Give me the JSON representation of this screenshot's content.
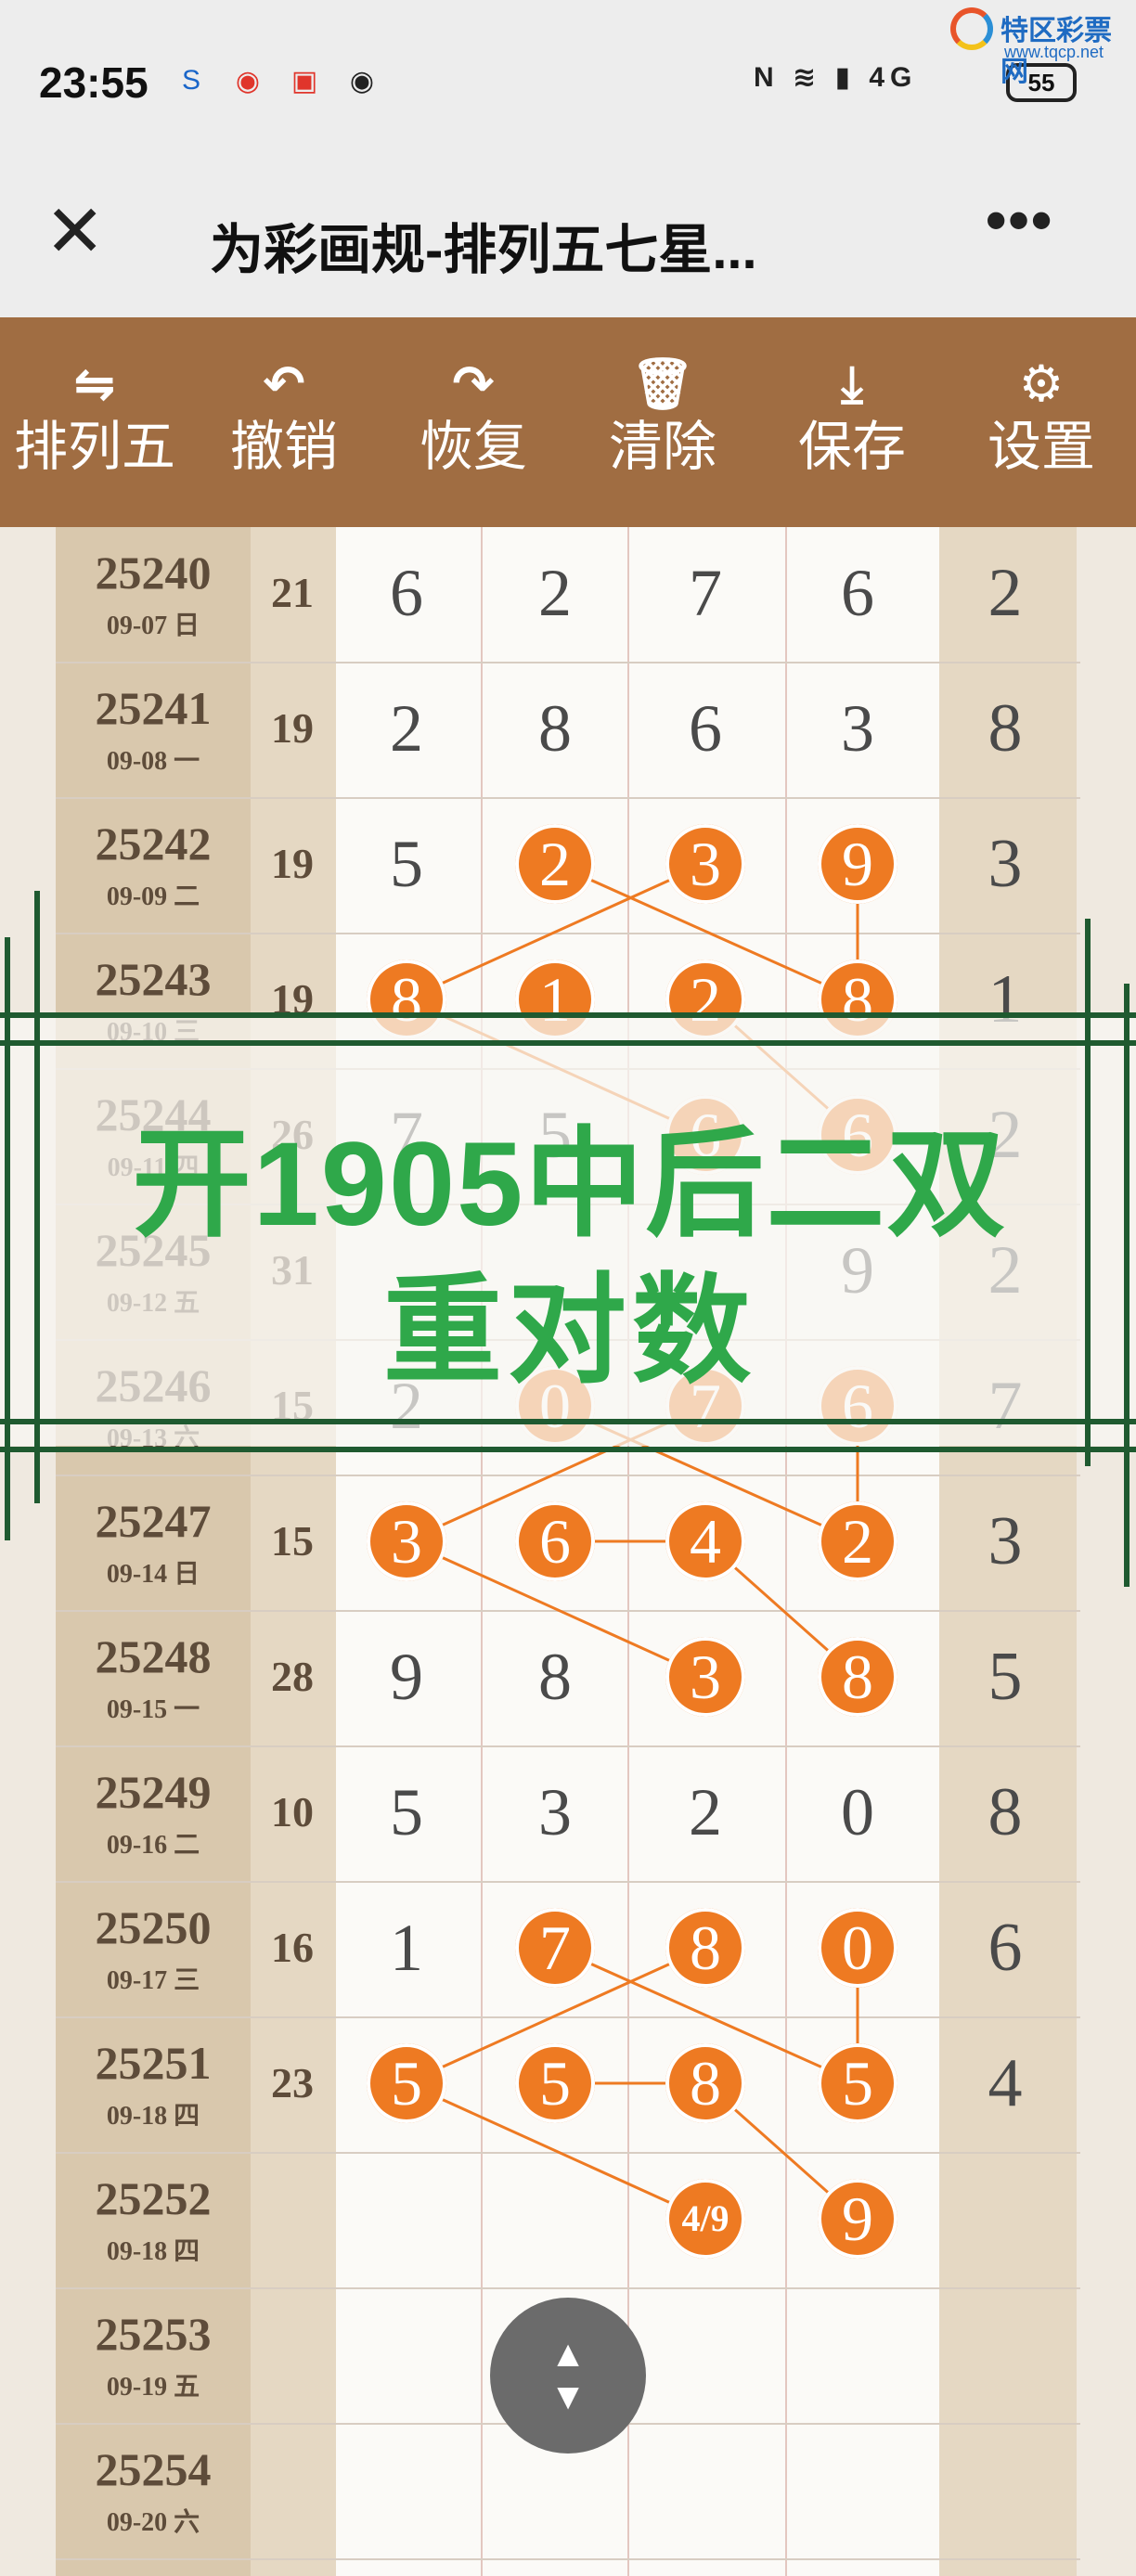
{
  "status_bar": {
    "time": "23:55",
    "battery": "55",
    "network": "4G",
    "watermark_name": "特区彩票网",
    "watermark_url": "www.tqcp.net"
  },
  "titlebar": {
    "close_icon": "close-icon",
    "title": "为彩画规-排列五七星...",
    "more_icon": "more-dots-icon"
  },
  "toolbar": [
    {
      "icon": "switch-arrows-icon",
      "glyph": "⇋",
      "label": "排列五"
    },
    {
      "icon": "undo-icon",
      "glyph": "↶",
      "label": "撤销"
    },
    {
      "icon": "redo-icon",
      "glyph": "↷",
      "label": "恢复"
    },
    {
      "icon": "trash-icon",
      "glyph": "🗑",
      "label": "清除"
    },
    {
      "icon": "download-icon",
      "glyph": "⤓",
      "label": "保存"
    },
    {
      "icon": "gear-icon",
      "glyph": "⚙",
      "label": "设置"
    }
  ],
  "table": {
    "rows": [
      {
        "period": "25240",
        "date": "09-07 日",
        "sum": "21",
        "digits": [
          "6",
          "2",
          "7",
          "6"
        ],
        "hl": [
          false,
          false,
          false,
          false
        ],
        "last": "2"
      },
      {
        "period": "25241",
        "date": "09-08 一",
        "sum": "19",
        "digits": [
          "2",
          "8",
          "6",
          "3"
        ],
        "hl": [
          false,
          false,
          false,
          false
        ],
        "last": "8"
      },
      {
        "period": "25242",
        "date": "09-09 二",
        "sum": "19",
        "digits": [
          "5",
          "2",
          "3",
          "9"
        ],
        "hl": [
          false,
          true,
          true,
          true
        ],
        "last": "3"
      },
      {
        "period": "25243",
        "date": "09-10 三",
        "sum": "19",
        "digits": [
          "8",
          "1",
          "2",
          "8"
        ],
        "hl": [
          true,
          true,
          true,
          true
        ],
        "last": "1"
      },
      {
        "period": "25244",
        "date": "09-11 四",
        "sum": "26",
        "digits": [
          "7",
          "5",
          "6",
          "6"
        ],
        "hl": [
          false,
          false,
          true,
          true
        ],
        "last": "2"
      },
      {
        "period": "25245",
        "date": "09-12 五",
        "sum": "31",
        "digits": [
          "",
          "",
          "",
          "9"
        ],
        "hl": [
          false,
          false,
          false,
          false
        ],
        "last": "2"
      },
      {
        "period": "25246",
        "date": "09-13 六",
        "sum": "15",
        "digits": [
          "2",
          "0",
          "7",
          "6"
        ],
        "hl": [
          false,
          true,
          true,
          true
        ],
        "last": "7"
      },
      {
        "period": "25247",
        "date": "09-14 日",
        "sum": "15",
        "digits": [
          "3",
          "6",
          "4",
          "2"
        ],
        "hl": [
          true,
          true,
          true,
          true
        ],
        "last": "3"
      },
      {
        "period": "25248",
        "date": "09-15 一",
        "sum": "28",
        "digits": [
          "9",
          "8",
          "3",
          "8"
        ],
        "hl": [
          false,
          false,
          true,
          true
        ],
        "last": "5"
      },
      {
        "period": "25249",
        "date": "09-16 二",
        "sum": "10",
        "digits": [
          "5",
          "3",
          "2",
          "0"
        ],
        "hl": [
          false,
          false,
          false,
          false
        ],
        "last": "8"
      },
      {
        "period": "25250",
        "date": "09-17 三",
        "sum": "16",
        "digits": [
          "1",
          "7",
          "8",
          "0"
        ],
        "hl": [
          false,
          true,
          true,
          true
        ],
        "last": "6"
      },
      {
        "period": "25251",
        "date": "09-18 四",
        "sum": "23",
        "digits": [
          "5",
          "5",
          "8",
          "5"
        ],
        "hl": [
          true,
          true,
          true,
          true
        ],
        "last": "4"
      },
      {
        "period": "25252",
        "date": "09-18 四",
        "sum": "",
        "digits": [
          "",
          "",
          "4/9",
          "9"
        ],
        "hl": [
          false,
          false,
          true,
          true
        ],
        "last": ""
      },
      {
        "period": "25253",
        "date": "09-19 五",
        "sum": "",
        "digits": [
          "",
          "",
          "",
          ""
        ],
        "hl": [
          false,
          false,
          false,
          false
        ],
        "last": ""
      },
      {
        "period": "25254",
        "date": "09-20 六",
        "sum": "",
        "digits": [
          "",
          "",
          "",
          ""
        ],
        "hl": [
          false,
          false,
          false,
          false
        ],
        "last": ""
      }
    ],
    "links": [
      [
        2,
        1,
        3,
        3
      ],
      [
        2,
        2,
        3,
        0
      ],
      [
        2,
        3,
        3,
        3
      ],
      [
        3,
        0,
        4,
        2
      ],
      [
        3,
        2,
        4,
        3
      ],
      [
        6,
        2,
        7,
        0
      ],
      [
        6,
        1,
        7,
        3
      ],
      [
        6,
        3,
        7,
        3
      ],
      [
        7,
        1,
        7,
        2
      ],
      [
        7,
        0,
        8,
        2
      ],
      [
        7,
        2,
        8,
        3
      ],
      [
        10,
        2,
        11,
        0
      ],
      [
        10,
        1,
        11,
        3
      ],
      [
        10,
        3,
        11,
        3
      ],
      [
        11,
        1,
        11,
        2
      ],
      [
        11,
        0,
        12,
        2
      ],
      [
        11,
        2,
        12,
        3
      ]
    ]
  },
  "banner": {
    "line1": "开1905中后二双",
    "line2": "重对数"
  },
  "scroll_button": {
    "up_glyph": "▲",
    "down_glyph": "▼",
    "icon": "scroll-updown-icon"
  }
}
